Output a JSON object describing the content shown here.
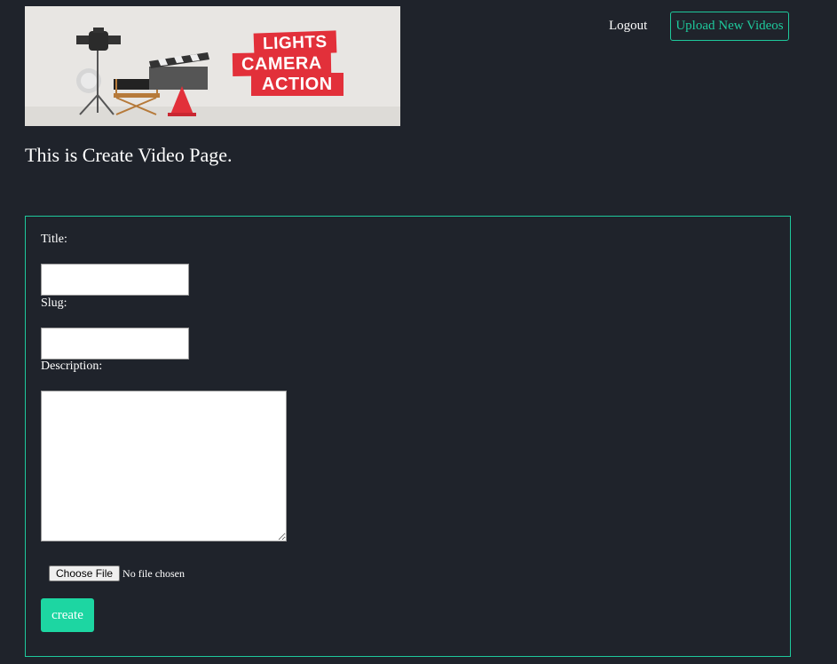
{
  "banner": {
    "slogan_line1": "LIGHTS",
    "slogan_line2": "CAMERA",
    "slogan_line3": "ACTION"
  },
  "nav": {
    "logout_label": "Logout",
    "upload_label": "Upload New Videos"
  },
  "page_title": "This is Create Video Page.",
  "form": {
    "title_label": "Title:",
    "title_value": "",
    "slug_label": "Slug:",
    "slug_value": "",
    "description_label": "Description:",
    "description_value": "",
    "file_button_label": "Choose File",
    "file_status": "No file chosen",
    "submit_label": "create"
  },
  "colors": {
    "background": "#1f232b",
    "accent": "#1ec99c",
    "button_fill": "#1dd6a2",
    "banner_red": "#e2303a"
  },
  "icons": [
    "spotlight-icon",
    "director-chair-icon",
    "clapperboard-icon",
    "traffic-cone-icon"
  ]
}
